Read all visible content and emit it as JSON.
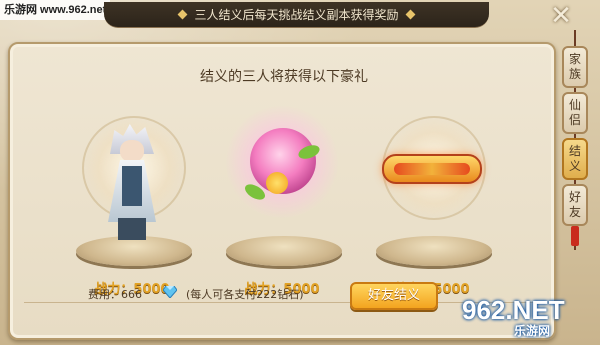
{
  "watermark_top": "乐游网 www.962.net",
  "banner": {
    "text": "三人结义后每天挑战结义副本获得奖励"
  },
  "close_label": "✕",
  "panel": {
    "title": "结义的三人将获得以下豪礼"
  },
  "rewards": [
    {
      "kind": "character",
      "power_label": "战力：5000"
    },
    {
      "kind": "flower",
      "power_label": "战力：5000"
    },
    {
      "kind": "title-badge",
      "power_label": "战力：5000"
    }
  ],
  "footer": {
    "fee_label": "费用：666",
    "currency_icon": "diamond-icon",
    "note": "(每人可各支付222钻石)",
    "button_label": "好友结义"
  },
  "side_tabs": [
    {
      "label": [
        "家",
        "族"
      ],
      "active": false
    },
    {
      "label": [
        "仙",
        "侣"
      ],
      "active": false
    },
    {
      "label": [
        "结",
        "义"
      ],
      "active": true
    },
    {
      "label": [
        "好",
        "友"
      ],
      "active": false
    }
  ],
  "watermark_bottom": {
    "main": "962.NET",
    "sub": "乐游网"
  },
  "colors": {
    "accent": "#f3a41f",
    "power_text": "#e3a325",
    "panel_bg": "#efe6d3",
    "banner_bg": "#2c241a"
  }
}
